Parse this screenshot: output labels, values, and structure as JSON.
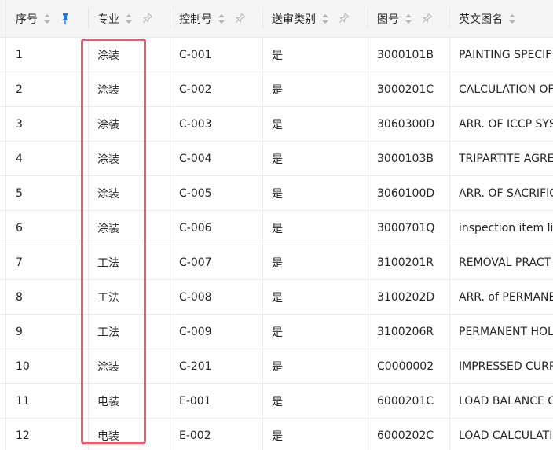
{
  "columns": [
    {
      "label": "序号",
      "pinned": true
    },
    {
      "label": "专业",
      "pinned": false
    },
    {
      "label": "控制号",
      "pinned": false
    },
    {
      "label": "送审类别",
      "pinned": false
    },
    {
      "label": "图号",
      "pinned": false
    },
    {
      "label": "英文图名",
      "pinned": false
    }
  ],
  "rows": [
    [
      "1",
      "涂装",
      "C-001",
      "是",
      "3000101B",
      "PAINTING SPECIF"
    ],
    [
      "2",
      "涂装",
      "C-002",
      "是",
      "3000201C",
      "CALCULATION OF"
    ],
    [
      "3",
      "涂装",
      "C-003",
      "是",
      "3060300D",
      "ARR. OF ICCP SYS"
    ],
    [
      "4",
      "涂装",
      "C-004",
      "是",
      "3000103B",
      "TRIPARTITE AGRE"
    ],
    [
      "5",
      "涂装",
      "C-005",
      "是",
      "3060100D",
      "ARR. OF SACRIFIC"
    ],
    [
      "6",
      "涂装",
      "C-006",
      "是",
      "3000701Q",
      "inspection item li"
    ],
    [
      "7",
      "工法",
      "C-007",
      "是",
      "3100201R",
      "REMOVAL PRACT"
    ],
    [
      "8",
      "工法",
      "C-008",
      "是",
      "3100202D",
      "ARR. of PERMANE"
    ],
    [
      "9",
      "工法",
      "C-009",
      "是",
      "3100206R",
      "PERMANENT HOL"
    ],
    [
      "10",
      "涂装",
      "C-201",
      "是",
      "C0000002",
      "IMPRESSED CURR"
    ],
    [
      "11",
      "电装",
      "E-001",
      "是",
      "6000201C",
      "LOAD BALANCE C"
    ],
    [
      "12",
      "电装",
      "E-002",
      "是",
      "6000202C",
      "LOAD CALCULATI"
    ]
  ],
  "colors": {
    "highlight": "#ef5a6a",
    "pin_active": "#1677ff"
  }
}
